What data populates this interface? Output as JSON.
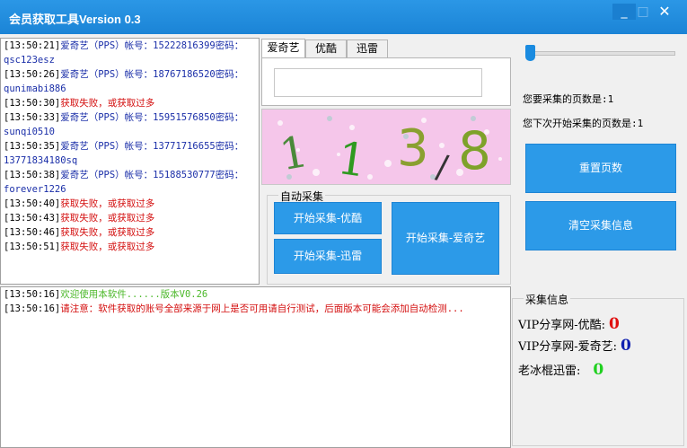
{
  "window": {
    "title": "会员获取工具Version 0.3",
    "min": "_",
    "max": "□",
    "close": "✕"
  },
  "log_top": [
    {
      "ts": "[13:50:21]",
      "parts": [
        {
          "t": "爱奇艺（PPS）帐号：15222816399密码：",
          "c": "blue"
        }
      ]
    },
    {
      "ts": "",
      "parts": [
        {
          "t": "qsc123esz",
          "c": "dark"
        }
      ]
    },
    {
      "ts": "[13:50:26]",
      "parts": [
        {
          "t": "爱奇艺（PPS）帐号：18767186520密码：",
          "c": "blue"
        }
      ]
    },
    {
      "ts": "",
      "parts": [
        {
          "t": "qunimabi886",
          "c": "dark"
        }
      ]
    },
    {
      "ts": "[13:50:30]",
      "parts": [
        {
          "t": "获取失败，或获取过多",
          "c": "red"
        }
      ]
    },
    {
      "ts": "[13:50:33]",
      "parts": [
        {
          "t": "爱奇艺（PPS）帐号：15951576850密码：",
          "c": "blue"
        }
      ]
    },
    {
      "ts": "",
      "parts": [
        {
          "t": "sunqi0510",
          "c": "dark"
        }
      ]
    },
    {
      "ts": "[13:50:35]",
      "parts": [
        {
          "t": "爱奇艺（PPS）帐号：13771716655密码：",
          "c": "blue"
        }
      ]
    },
    {
      "ts": "",
      "parts": [
        {
          "t": "13771834180sq",
          "c": "dark"
        }
      ]
    },
    {
      "ts": "[13:50:38]",
      "parts": [
        {
          "t": "爱奇艺（PPS）帐号：15188530777密码：",
          "c": "blue"
        }
      ]
    },
    {
      "ts": "",
      "parts": [
        {
          "t": "forever1226",
          "c": "dark"
        }
      ]
    },
    {
      "ts": "[13:50:40]",
      "parts": [
        {
          "t": "获取失败，或获取过多",
          "c": "red"
        }
      ]
    },
    {
      "ts": "[13:50:43]",
      "parts": [
        {
          "t": "获取失败，或获取过多",
          "c": "red"
        }
      ]
    },
    {
      "ts": "[13:50:46]",
      "parts": [
        {
          "t": "获取失败，或获取过多",
          "c": "red"
        }
      ]
    },
    {
      "ts": "[13:50:51]",
      "parts": [
        {
          "t": "获取失败，或获取过多",
          "c": "red"
        }
      ]
    }
  ],
  "log_bottom": [
    {
      "ts": "[13:50:16]",
      "parts": [
        {
          "t": "欢迎使用本软件......版本V0.26",
          "c": "green"
        }
      ]
    },
    {
      "ts": "[13:50:16]",
      "parts": [
        {
          "t": "请注意：软件获取的账号全部来源于网上是否可用请自行测试，后面版本可能会添加自动检测...",
          "c": "red"
        }
      ]
    }
  ],
  "tabs": [
    "爱奇艺",
    "优酷",
    "迅雷"
  ],
  "captcha": {
    "chars": [
      "1",
      "1",
      "3",
      "/",
      "8"
    ]
  },
  "auto_group": {
    "title": "自动采集",
    "btn_youku": "开始采集-优酷",
    "btn_xunlei": "开始采集-迅雷",
    "btn_iqiyi": "开始采集-爱奇艺"
  },
  "slider": {
    "value": 1
  },
  "pages": {
    "want": "您要采集的页数是:1",
    "next": "您下次开始采集的页数是:1"
  },
  "buttons": {
    "reset": "重置页数",
    "clear": "清空采集信息"
  },
  "collect_info": {
    "title": "采集信息",
    "youku_label": "VIP分享网-优酷:",
    "youku_value": "0",
    "iqiyi_label": "VIP分享网-爱奇艺:",
    "iqiyi_value": "0",
    "xunlei_label": "老冰棍迅雷:",
    "xunlei_value": "0"
  },
  "colors": {
    "accent": "#2c9ae8",
    "titlebar": "#1b84d6"
  }
}
